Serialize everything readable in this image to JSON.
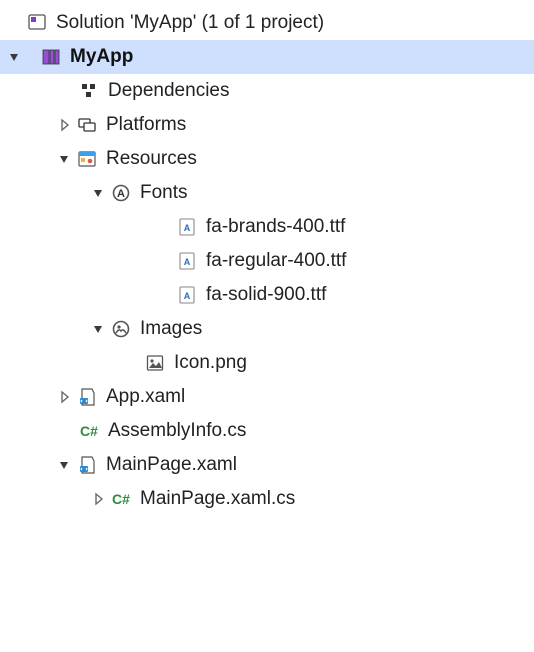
{
  "root": {
    "solution_label": "Solution 'MyApp' (1 of 1 project)",
    "project_label": "MyApp",
    "nodes": {
      "dependencies": "Dependencies",
      "platforms": "Platforms",
      "resources": "Resources",
      "fonts": "Fonts",
      "fa_brands": "fa-brands-400.ttf",
      "fa_regular": "fa-regular-400.ttf",
      "fa_solid": "fa-solid-900.ttf",
      "images": "Images",
      "icon_png": "Icon.png",
      "app_xaml": "App.xaml",
      "assemblyinfo": "AssemblyInfo.cs",
      "mainpage_xaml": "MainPage.xaml",
      "mainpage_xaml_cs": "MainPage.xaml.cs"
    }
  }
}
